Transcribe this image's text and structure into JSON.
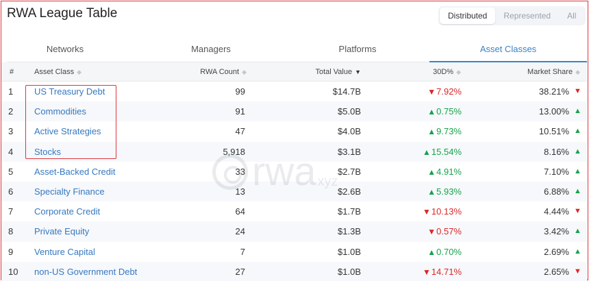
{
  "page": {
    "title": "RWA League Table"
  },
  "toggle": {
    "options": [
      "Distributed",
      "Represented",
      "All"
    ],
    "active": 0
  },
  "tabs": [
    "Networks",
    "Managers",
    "Platforms",
    "Asset Classes"
  ],
  "active_tab": 3,
  "table": {
    "headers": {
      "index": "#",
      "name": "Asset Class",
      "count": "RWA Count",
      "value": "Total Value",
      "change": "30D%",
      "share": "Market Share"
    },
    "rows": [
      {
        "idx": "1",
        "name": "US Treasury Debt",
        "count": "99",
        "value": "$14.7B",
        "change": "7.92%",
        "change_dir": "down",
        "share": "38.21%",
        "share_dir": "down"
      },
      {
        "idx": "2",
        "name": "Commodities",
        "count": "91",
        "value": "$5.0B",
        "change": "0.75%",
        "change_dir": "up",
        "share": "13.00%",
        "share_dir": "up"
      },
      {
        "idx": "3",
        "name": "Active Strategies",
        "count": "47",
        "value": "$4.0B",
        "change": "9.73%",
        "change_dir": "up",
        "share": "10.51%",
        "share_dir": "up"
      },
      {
        "idx": "4",
        "name": "Stocks",
        "count": "5,918",
        "value": "$3.1B",
        "change": "15.54%",
        "change_dir": "up",
        "share": "8.16%",
        "share_dir": "up"
      },
      {
        "idx": "5",
        "name": "Asset-Backed Credit",
        "count": "33",
        "value": "$2.7B",
        "change": "4.91%",
        "change_dir": "up",
        "share": "7.10%",
        "share_dir": "up"
      },
      {
        "idx": "6",
        "name": "Specialty Finance",
        "count": "13",
        "value": "$2.6B",
        "change": "5.93%",
        "change_dir": "up",
        "share": "6.88%",
        "share_dir": "up"
      },
      {
        "idx": "7",
        "name": "Corporate Credit",
        "count": "64",
        "value": "$1.7B",
        "change": "10.13%",
        "change_dir": "down",
        "share": "4.44%",
        "share_dir": "down"
      },
      {
        "idx": "8",
        "name": "Private Equity",
        "count": "24",
        "value": "$1.3B",
        "change": "0.57%",
        "change_dir": "down",
        "share": "3.42%",
        "share_dir": "up"
      },
      {
        "idx": "9",
        "name": "Venture Capital",
        "count": "7",
        "value": "$1.0B",
        "change": "0.70%",
        "change_dir": "up",
        "share": "2.69%",
        "share_dir": "up"
      },
      {
        "idx": "10",
        "name": "non-US Government Debt",
        "count": "27",
        "value": "$1.0B",
        "change": "14.71%",
        "change_dir": "down",
        "share": "2.65%",
        "share_dir": "down"
      }
    ]
  },
  "watermark": {
    "text": "rwa",
    "sub": "xyz"
  },
  "colors": {
    "accent": "#3b82c4",
    "up": "#16a34a",
    "down": "#dc2626",
    "highlight": "#d9363e"
  }
}
